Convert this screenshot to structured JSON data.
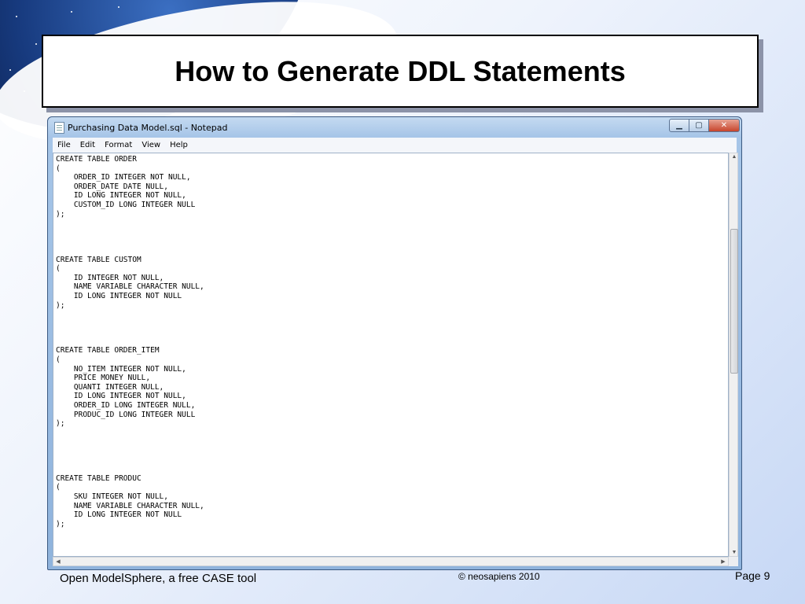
{
  "slide": {
    "title": "How to Generate DDL Statements"
  },
  "window": {
    "title": "Purchasing Data Model.sql - Notepad",
    "controls": {
      "minimize": "▁",
      "maximize": "▢",
      "close": "✕"
    },
    "menu": [
      "File",
      "Edit",
      "Format",
      "View",
      "Help"
    ],
    "content": "CREATE TABLE ORDER\n(\n    ORDER_ID INTEGER NOT NULL,\n    ORDER_DATE DATE NULL,\n    ID LONG INTEGER NOT NULL,\n    CUSTOM_ID LONG INTEGER NULL\n);\n\n\n\n\nCREATE TABLE CUSTOM\n(\n    ID INTEGER NOT NULL,\n    NAME VARIABLE CHARACTER NULL,\n    ID LONG INTEGER NOT NULL\n);\n\n\n\n\nCREATE TABLE ORDER_ITEM\n(\n    NO_ITEM INTEGER NOT NULL,\n    PRICE MONEY NULL,\n    QUANTI INTEGER NULL,\n    ID LONG INTEGER NOT NULL,\n    ORDER_ID LONG INTEGER NULL,\n    PRODUC_ID LONG INTEGER NULL\n);\n\n\n\n\n\nCREATE TABLE PRODUC\n(\n    SKU INTEGER NOT NULL,\n    NAME VARIABLE CHARACTER NULL,\n    ID LONG INTEGER NOT NULL\n);"
  },
  "footer": {
    "left": "Open ModelSphere, a free CASE tool",
    "center": "© neosapiens 2010",
    "right": "Page 9"
  }
}
